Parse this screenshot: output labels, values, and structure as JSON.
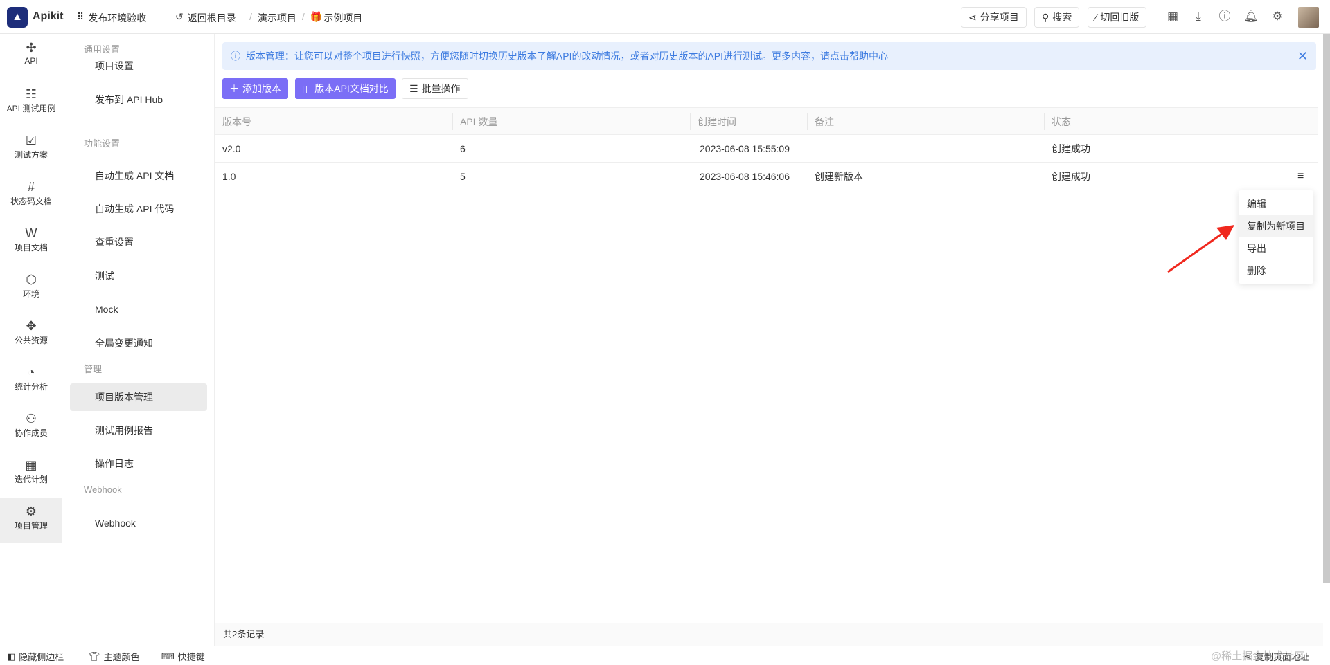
{
  "header": {
    "brand": "Apikit",
    "workspace": "发布环境验收",
    "back": "返回根目录",
    "breadcrumb": [
      "演示项目",
      "示例项目"
    ],
    "share": "分享项目",
    "search": "搜索",
    "old_version": "切回旧版",
    "icons": [
      "calendar-icon",
      "download-icon",
      "help-icon",
      "bell-icon",
      "gear-icon"
    ]
  },
  "iconbar": [
    {
      "label": "API",
      "icon": "✣"
    },
    {
      "label": "API 测试用例",
      "icon": "☷"
    },
    {
      "label": "测试方案",
      "icon": "☑"
    },
    {
      "label": "状态码文档",
      "icon": "#"
    },
    {
      "label": "项目文档",
      "icon": "W"
    },
    {
      "label": "环境",
      "icon": "⬡"
    },
    {
      "label": "公共资源",
      "icon": "✥"
    },
    {
      "label": "统计分析",
      "icon": "◔"
    },
    {
      "label": "协作成员",
      "icon": "⚇"
    },
    {
      "label": "迭代计划",
      "icon": "▦"
    },
    {
      "label": "项目管理",
      "icon": "⚙",
      "active": true
    }
  ],
  "sidebar": {
    "sections": [
      {
        "title": "通用设置",
        "items": [
          "项目设置",
          "发布到 API Hub"
        ]
      },
      {
        "title": "功能设置",
        "items": [
          "自动生成 API 文档",
          "自动生成 API 代码",
          "查重设置",
          "测试",
          "Mock",
          "全局变更通知"
        ]
      },
      {
        "title": "管理",
        "items": [
          "项目版本管理",
          "测试用例报告",
          "操作日志"
        ]
      },
      {
        "title": "Webhook",
        "items": [
          "Webhook"
        ]
      }
    ],
    "active": "项目版本管理"
  },
  "banner": {
    "text": "版本管理：让您可以对整个项目进行快照，方便您随时切换历史版本了解API的改动情况，或者对历史版本的API进行测试。更多内容，请点击帮助中心"
  },
  "toolbar": {
    "add": "添加版本",
    "compare": "版本API文档对比",
    "batch": "批量操作"
  },
  "table": {
    "columns": [
      "版本号",
      "API 数量",
      "创建时间",
      "备注",
      "状态"
    ],
    "rows": [
      [
        "v2.0",
        "6",
        "2023-06-08 15:55:09",
        "",
        "创建成功"
      ],
      [
        "1.0",
        "5",
        "2023-06-08 15:46:06",
        "创建新版本",
        "创建成功"
      ]
    ]
  },
  "menu": {
    "items": [
      "编辑",
      "复制为新项目",
      "导出",
      "删除"
    ],
    "hovered": "复制为新项目"
  },
  "footer": {
    "total": "共2条记录"
  },
  "bottombar": {
    "hide_sidebar": "隐藏侧边栏",
    "theme": "主题颜色",
    "shortcuts": "快捷键",
    "copy_url": "复制页面地址",
    "watermark": "@稀土掘金技术社区"
  },
  "colors": {
    "primary": "#7b6ef6",
    "banner_bg": "#e8f0fd",
    "banner_text": "#3d7be0",
    "arrow": "#f0281e"
  }
}
